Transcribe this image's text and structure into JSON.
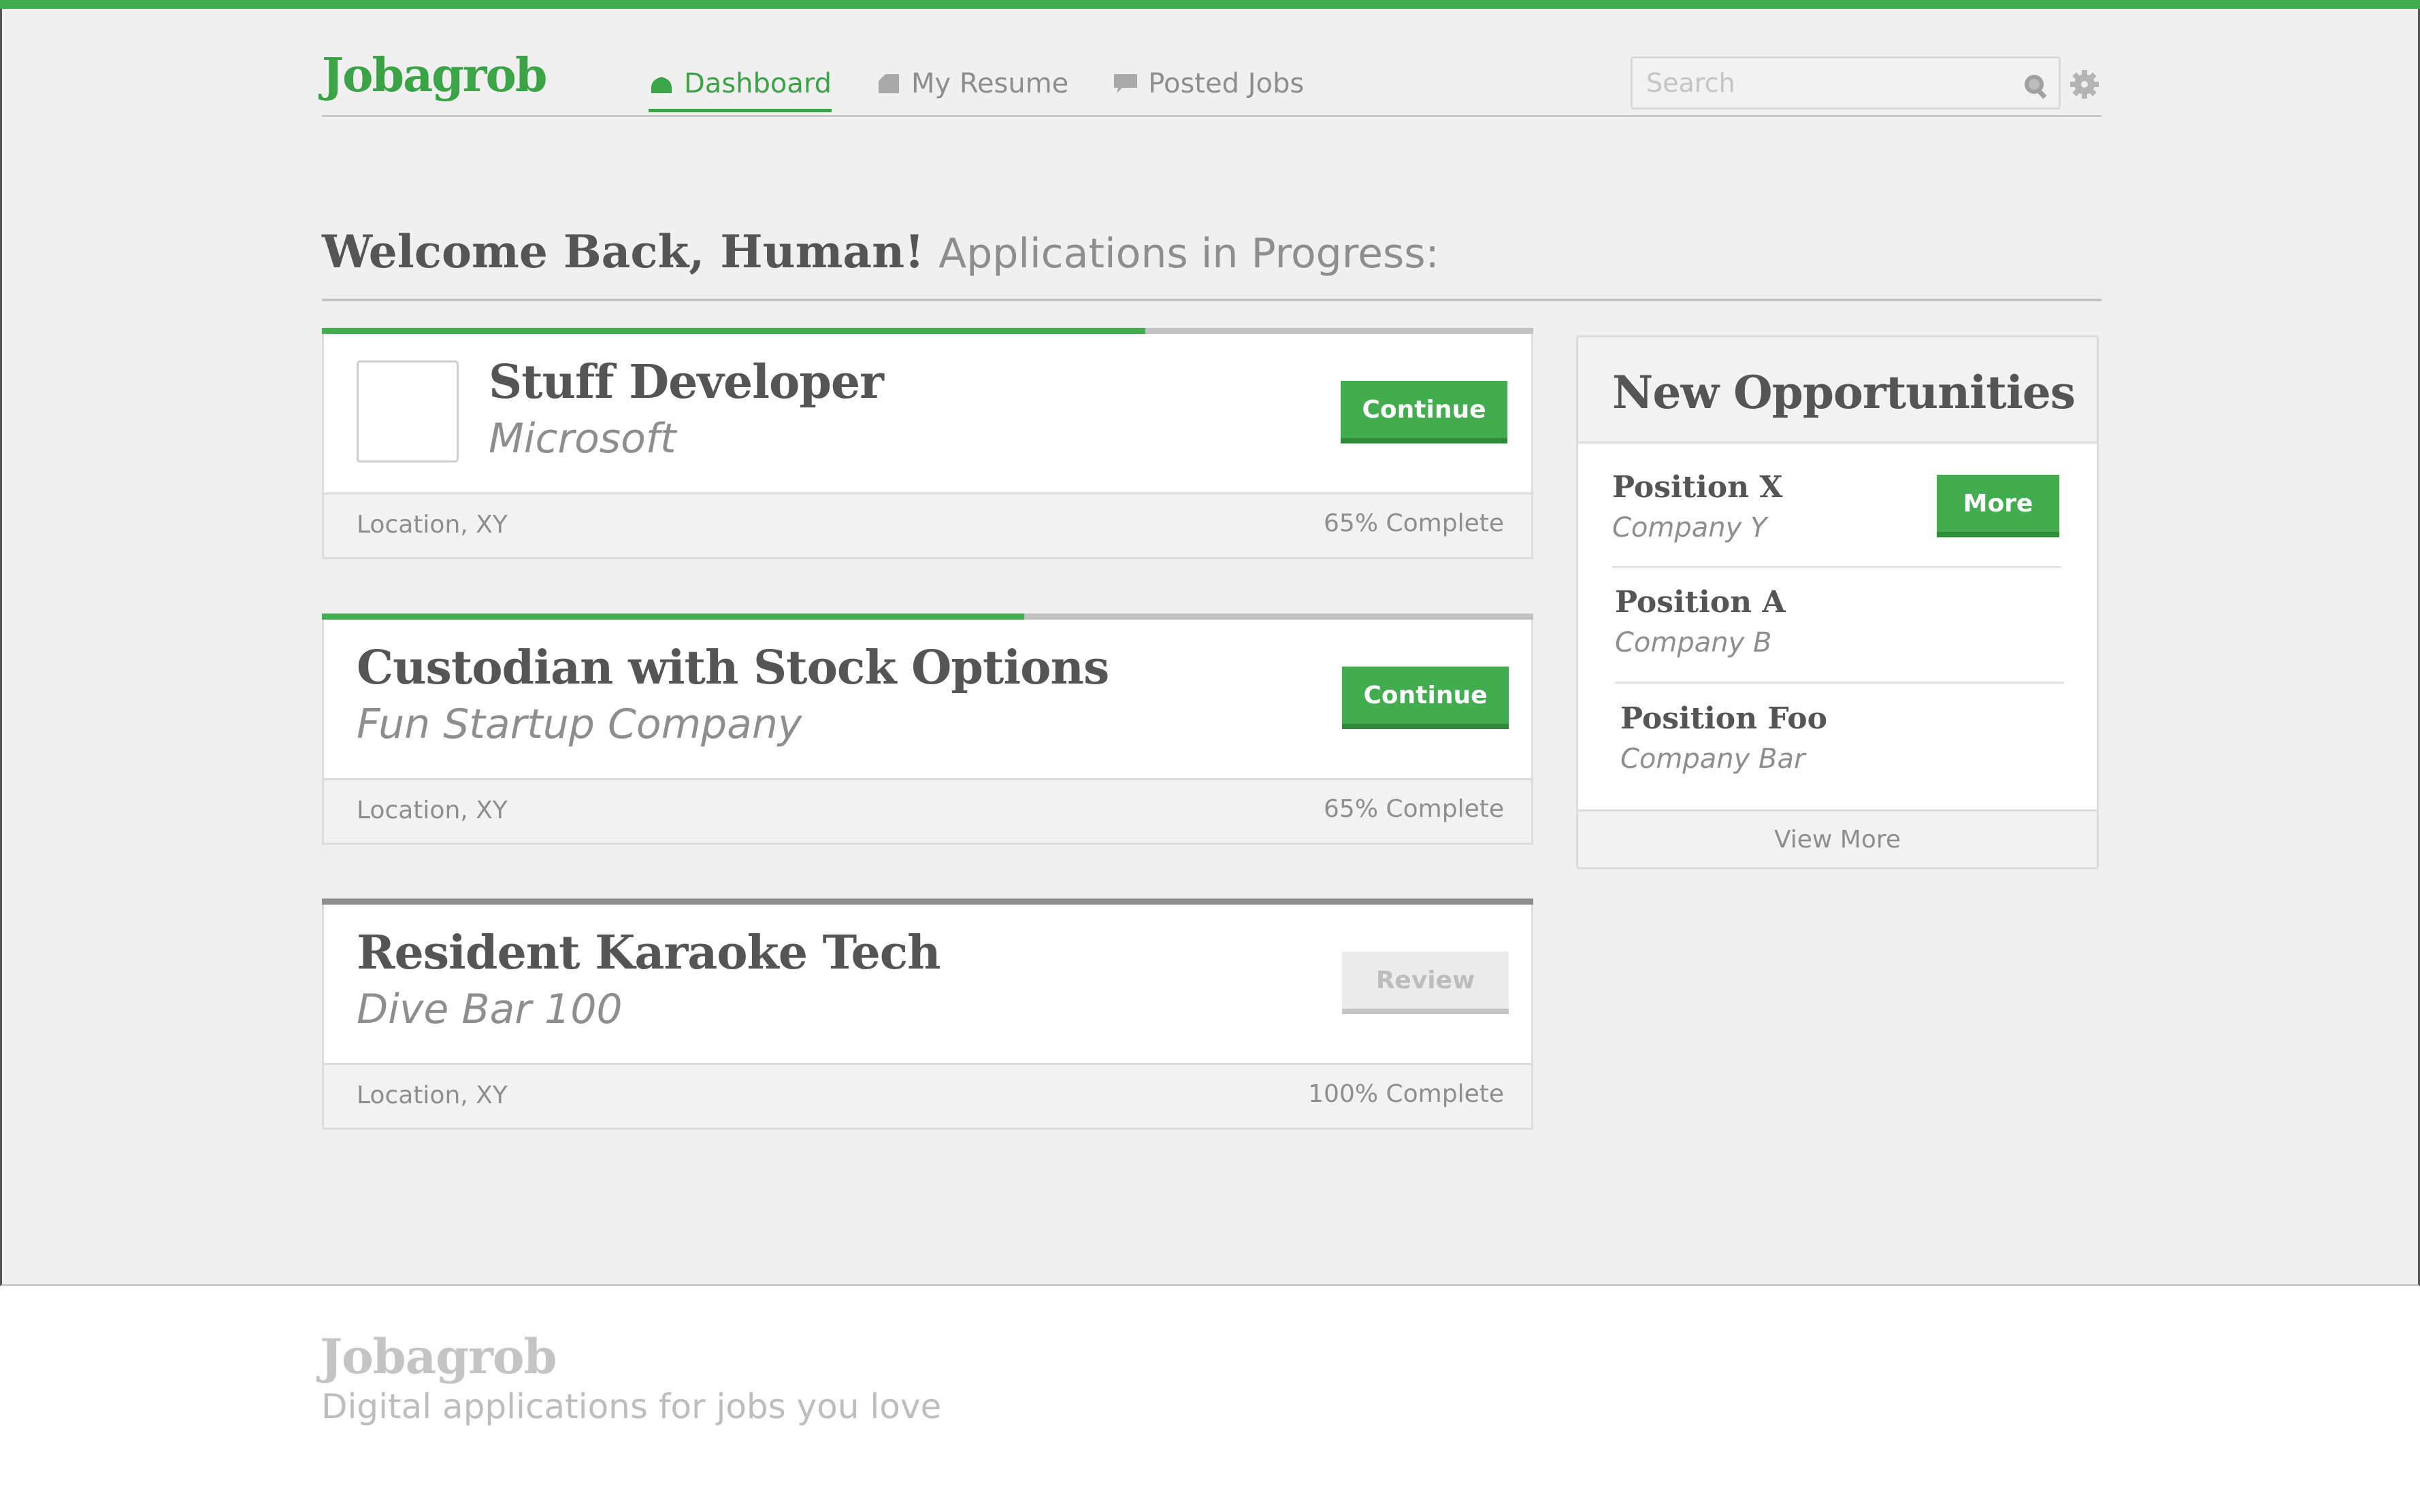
{
  "app": {
    "name": "Jobagrob",
    "accent": "#41ad4f"
  },
  "nav": [
    {
      "label": "Dashboard",
      "icon": "cloud-icon",
      "active": true
    },
    {
      "label": "My Resume",
      "icon": "document-icon",
      "active": false
    },
    {
      "label": "Posted Jobs",
      "icon": "chat-bubble-icon",
      "active": false
    }
  ],
  "search": {
    "placeholder": "Search",
    "icon": "search-icon"
  },
  "settings_icon": "gear-icon",
  "page": {
    "greeting": "Welcome Back, Human!",
    "subtitle": "Applications in Progress:"
  },
  "applications": [
    {
      "title": "Stuff Developer",
      "company": "Microsoft",
      "location": "Location, XY",
      "complete_text": "65% Complete",
      "progress": 0.68,
      "action": "Continue",
      "has_logo": true
    },
    {
      "title": "Custodian with Stock Options",
      "company": "Fun Startup Company",
      "location": "Location, XY",
      "complete_text": "65% Complete",
      "progress": 0.58,
      "action": "Continue",
      "has_logo": false
    },
    {
      "title": "Resident Karaoke Tech",
      "company": "Dive Bar 100",
      "location": "Location, XY",
      "complete_text": "100% Complete",
      "progress": 1.0,
      "action": "Review",
      "has_logo": false
    }
  ],
  "opportunities": {
    "title": "New Opportunities",
    "items": [
      {
        "position": "Position X",
        "company": "Company Y",
        "action": "More"
      },
      {
        "position": "Position A",
        "company": "Company B"
      },
      {
        "position": "Position Foo",
        "company": "Company Bar"
      }
    ],
    "view_more": "View More"
  },
  "footer": {
    "logo": "Jobagrob",
    "tagline": "Digital applications for jobs you love"
  }
}
